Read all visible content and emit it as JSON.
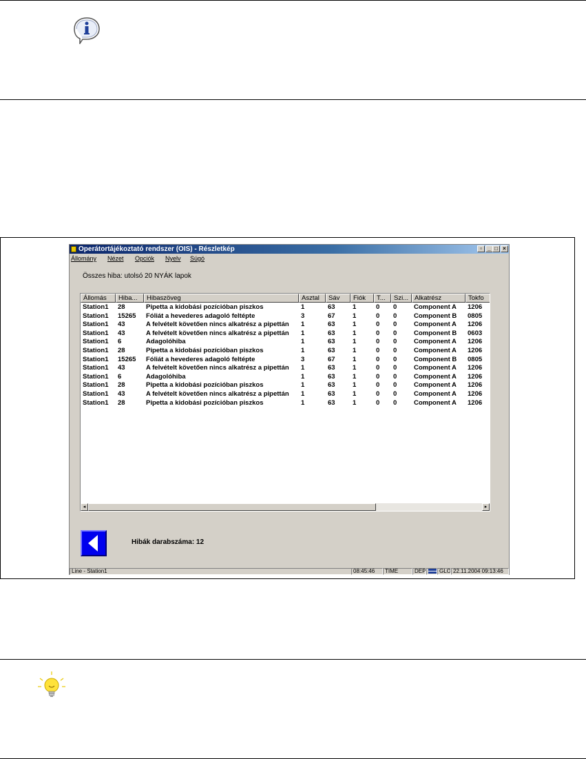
{
  "window": {
    "title": "Operátortájékoztató rendszer (OIS) - Részletkép",
    "menu": [
      "Állomány",
      "Nézet",
      "Opciók",
      "Nyelv",
      "Súgó"
    ]
  },
  "summary": {
    "label": "Összes hiba:",
    "value": "utolsó 20 NYÁK lapok"
  },
  "table": {
    "columns": [
      "Állomás",
      "Hiba...",
      "Hibaszöveg",
      "Asztal",
      "Sáv",
      "Fiók",
      "T...",
      "Szi...",
      "Alkatrész",
      "Tokfo"
    ],
    "rows": [
      [
        "Station1",
        "28",
        "Pipetta a kidobási pozícióban piszkos",
        "1",
        "63",
        "1",
        "0",
        "0",
        "Component A",
        "1206"
      ],
      [
        "Station1",
        "15265",
        "Fóliát a hevederes adagoló feltépte",
        "3",
        "67",
        "1",
        "0",
        "0",
        "Component B",
        "0805"
      ],
      [
        "Station1",
        "43",
        "A felvételt követően nincs alkatrész a pipettán",
        "1",
        "63",
        "1",
        "0",
        "0",
        "Component A",
        "1206"
      ],
      [
        "Station1",
        "43",
        "A felvételt követően nincs alkatrész a pipettán",
        "1",
        "63",
        "1",
        "0",
        "0",
        "Component B",
        "0603"
      ],
      [
        "Station1",
        "6",
        "Adagolóhiba",
        "1",
        "63",
        "1",
        "0",
        "0",
        "Component A",
        "1206"
      ],
      [
        "Station1",
        "28",
        "Pipetta a kidobási pozícióban piszkos",
        "1",
        "63",
        "1",
        "0",
        "0",
        "Component A",
        "1206"
      ],
      [
        "Station1",
        "15265",
        "Fóliát a hevederes adagoló feltépte",
        "3",
        "67",
        "1",
        "0",
        "0",
        "Component B",
        "0805"
      ],
      [
        "Station1",
        "43",
        "A felvételt követően nincs alkatrész a pipettán",
        "1",
        "63",
        "1",
        "0",
        "0",
        "Component A",
        "1206"
      ],
      [
        "Station1",
        "6",
        "Adagolóhiba",
        "1",
        "63",
        "1",
        "0",
        "0",
        "Component A",
        "1206"
      ],
      [
        "Station1",
        "28",
        "Pipetta a kidobási pozícióban piszkos",
        "1",
        "63",
        "1",
        "0",
        "0",
        "Component A",
        "1206"
      ],
      [
        "Station1",
        "43",
        "A felvételt követően nincs alkatrész a pipettán",
        "1",
        "63",
        "1",
        "0",
        "0",
        "Component A",
        "1206"
      ],
      [
        "Station1",
        "28",
        "Pipetta a kidobási pozícióban piszkos",
        "1",
        "63",
        "1",
        "0",
        "0",
        "Component A",
        "1206"
      ]
    ]
  },
  "footer": {
    "count_label": "Hibák darabszáma: 12"
  },
  "statusbar": {
    "line": "Line - Station1",
    "clock": "08:45:46",
    "time_label": "TIME",
    "lang": "DEP",
    "mode": "GLO",
    "datetime": "22.11.2004 09:13:46"
  },
  "icons": {
    "top_note": "info-icon",
    "bottom_note": "lightbulb-tip-icon",
    "back": "back-arrow-icon"
  },
  "colors": {
    "titlebar_start": "#0a246a",
    "back_button": "#0000ee",
    "window_face": "#d4d0c8"
  }
}
